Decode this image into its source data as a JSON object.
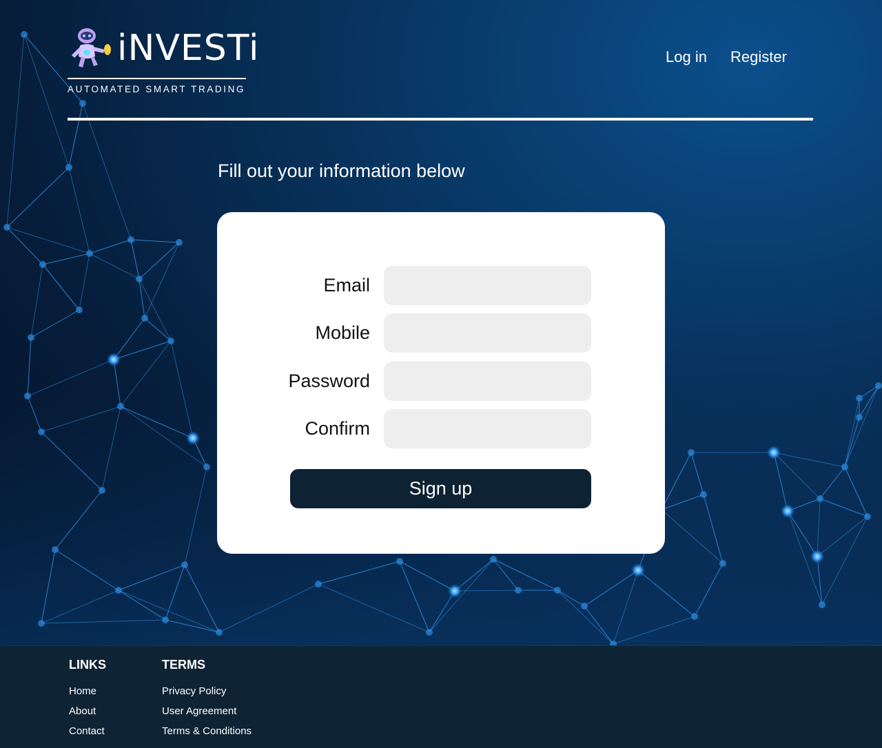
{
  "brand": {
    "name": "iNVESTi",
    "tagline": "AUTOMATED SMART TRADING",
    "mascot_icon": "robot-mascot-icon"
  },
  "nav": {
    "login_label": "Log in",
    "register_label": "Register"
  },
  "form": {
    "intro": "Fill out your information below",
    "fields": [
      {
        "label": "Email",
        "value": "",
        "placeholder": ""
      },
      {
        "label": "Mobile",
        "value": "",
        "placeholder": ""
      },
      {
        "label": "Password",
        "value": "",
        "placeholder": ""
      },
      {
        "label": "Confirm",
        "value": "",
        "placeholder": ""
      }
    ],
    "submit_label": "Sign up"
  },
  "footer": {
    "links_heading": "LINKS",
    "links": [
      "Home",
      "About",
      "Contact"
    ],
    "terms_heading": "TERMS",
    "terms": [
      "Privacy Policy",
      "User Agreement",
      "Terms & Conditions"
    ]
  },
  "colors": {
    "background_dark": "#061d3a",
    "background_glow": "#0b4f8c",
    "card": "#ffffff",
    "input_fill": "#eeeeee",
    "button": "#0d2233",
    "footer": "#0e2333",
    "network_accent": "#3aa3ff"
  }
}
